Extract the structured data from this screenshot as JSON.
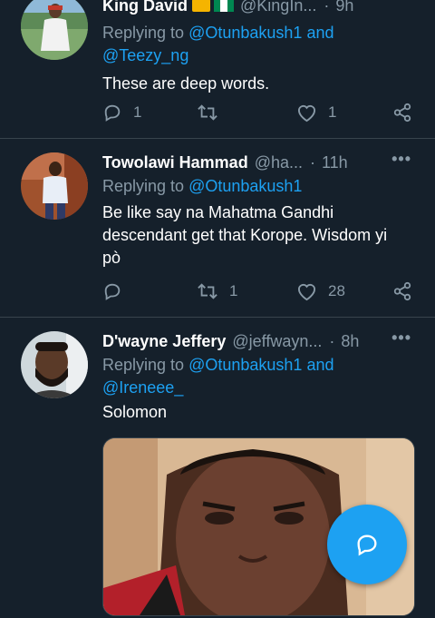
{
  "tweets": [
    {
      "name": "King David",
      "handle": "@KingIn...",
      "time": "9h",
      "replying_prefix": "Replying to",
      "mention1": "@Otunbakush1",
      "and": "and",
      "mention2": "@Teezy_ng",
      "text": "These are deep words.",
      "reply_count": "1",
      "retweet_count": "",
      "like_count": "1"
    },
    {
      "name": "Towolawi Hammad",
      "handle": "@ha...",
      "time": "11h",
      "replying_prefix": "Replying to",
      "mention1": "@Otunbakush1",
      "text_line1": "Be like say na Mahatma Gandhi",
      "text_line2": "descendant get that Korope. Wisdom yi",
      "text_line3": "pò",
      "reply_count": "",
      "retweet_count": "1",
      "like_count": "28"
    },
    {
      "name": "D'wayne Jeffery",
      "handle": "@jeffwayn...",
      "time": "8h",
      "replying_prefix": "Replying to",
      "mention1": "@Otunbakush1",
      "and": "and",
      "mention2": "@Ireneee_",
      "text": "Solomon"
    }
  ],
  "more_label": "•••",
  "separator": "·",
  "colors": {
    "background": "#15202b",
    "accent": "#1da1f2",
    "secondary_text": "#8899a6",
    "divider": "#38444d"
  },
  "icons": {
    "reply": "reply-icon",
    "retweet": "retweet-icon",
    "like": "heart-icon",
    "share": "share-icon",
    "compose": "compose-reply-icon"
  }
}
